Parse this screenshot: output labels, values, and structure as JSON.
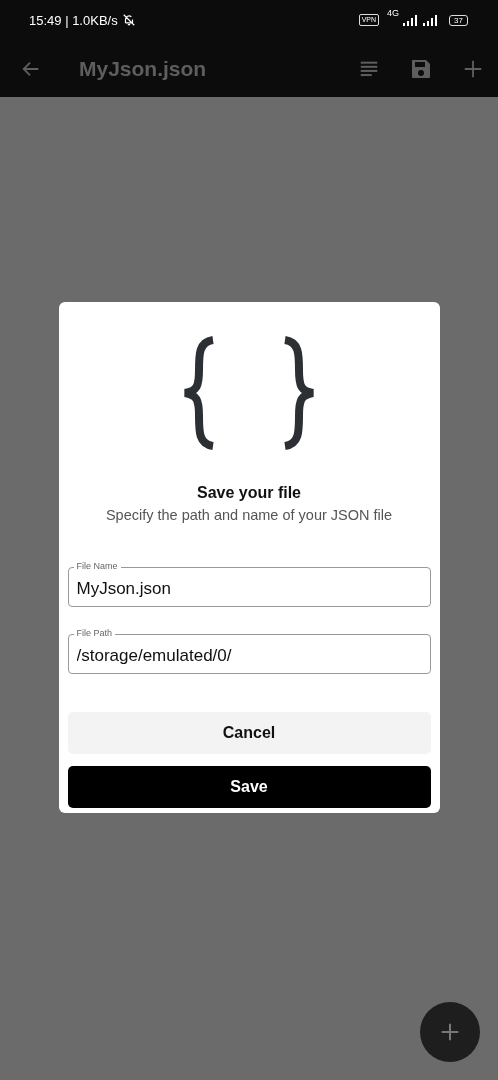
{
  "status_bar": {
    "time": "15:49 | 1.0KB/s",
    "vpn": "VPN",
    "network": "4G",
    "battery": "37"
  },
  "app_bar": {
    "title": "MyJson.json"
  },
  "dialog": {
    "title": "Save your file",
    "subtitle": "Specify the path and name of your JSON file",
    "fields": [
      {
        "label": "File Name",
        "value": "MyJson.json"
      },
      {
        "label": "File Path",
        "value": "/storage/emulated/0/"
      }
    ],
    "buttons": [
      {
        "label": "Cancel",
        "kind": "secondary"
      },
      {
        "label": "Save",
        "kind": "primary"
      }
    ]
  }
}
